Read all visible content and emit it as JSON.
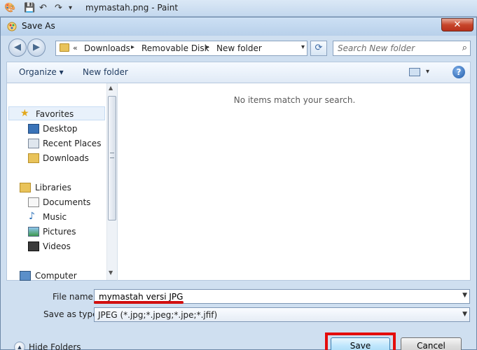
{
  "paint": {
    "title": "mymastah.png - Paint"
  },
  "dialog": {
    "title": "Save As",
    "close_glyph": "✕"
  },
  "address": {
    "prefix": "«",
    "crumbs": [
      "Downloads",
      "Removable Disk",
      "New folder"
    ],
    "separator": "▸",
    "dropdown_glyph": "▾"
  },
  "search": {
    "placeholder": "Search New folder"
  },
  "toolbar": {
    "organize_label": "Organize ▾",
    "new_folder_label": "New folder",
    "view_chevron": "▾",
    "help_glyph": "?"
  },
  "nav_tree": {
    "favorites": "Favorites",
    "desktop": "Desktop",
    "recent_places": "Recent Places",
    "downloads": "Downloads",
    "libraries": "Libraries",
    "documents": "Documents",
    "music": "Music",
    "pictures": "Pictures",
    "videos": "Videos",
    "computer": "Computer"
  },
  "content": {
    "empty_message": "No items match your search."
  },
  "form": {
    "file_name_label": "File name:",
    "file_name_value": "mymastah versi JPG",
    "save_as_type_label": "Save as type:",
    "save_as_type_value": "JPEG (*.jpg;*.jpeg;*.jpe;*.jfif)"
  },
  "footer": {
    "hide_folders_label": "Hide Folders",
    "save_label": "Save",
    "cancel_label": "Cancel"
  },
  "colors": {
    "highlight_red": "#e40c0c",
    "dialog_bg": "#cfdff0"
  }
}
